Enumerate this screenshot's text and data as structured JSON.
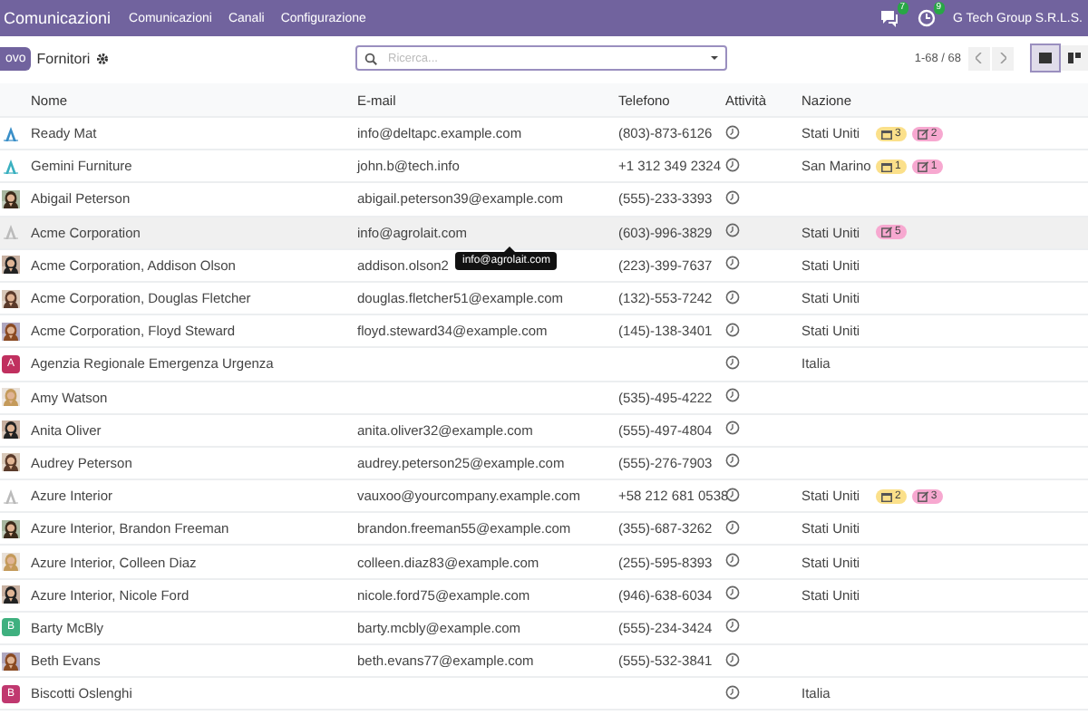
{
  "topbar": {
    "app": "Comunicazioni",
    "menus": [
      "Comunicazioni",
      "Canali",
      "Configurazione"
    ],
    "chat_badge": "7",
    "activity_badge": "9",
    "company": "G Tech Group S.R.L.S."
  },
  "control": {
    "new_button": "ovo",
    "title": "Fornitori",
    "search": {
      "placeholder": "Ricerca..."
    },
    "pager": "1-68 / 68",
    "views": [
      {
        "kind": "list",
        "selected": true
      },
      {
        "kind": "kanban",
        "selected": false
      }
    ]
  },
  "table": {
    "columns": [
      "Nome",
      "E-mail",
      "Telefono",
      "Attività",
      "Nazione"
    ],
    "rows": [
      {
        "avatar": {
          "kind": "logo"
        },
        "name": "Ready Mat",
        "email": "info@deltapc.example.com",
        "phone": "(803)-873-6126",
        "country": "Stati Uniti",
        "tags": [
          {
            "kind": "calendar",
            "count": "3"
          },
          {
            "kind": "note",
            "count": "2"
          }
        ],
        "highlighted": false
      },
      {
        "avatar": {
          "kind": "logo"
        },
        "name": "Gemini Furniture",
        "email": "john.b@tech.info",
        "phone": "+1 312 349 2324",
        "country": "San Marino",
        "tags": [
          {
            "kind": "calendar",
            "count": "1"
          },
          {
            "kind": "note",
            "count": "1"
          }
        ],
        "highlighted": false
      },
      {
        "name": "Abigail Peterson",
        "email": "abigail.peterson39@example.com",
        "phone": "(555)-233-3393",
        "highlighted": false
      },
      {
        "avatar": {
          "kind": "logo"
        },
        "name": "Acme Corporation",
        "email": "info@agrolait.com",
        "phone": "(603)-996-3829",
        "country": "Stati Uniti",
        "tags": [
          {
            "kind": "note",
            "count": "5"
          }
        ],
        "highlighted": true
      },
      {
        "name": "Acme Corporation, Addison Olson",
        "email": "addison.olson2",
        "phone": "(223)-399-7637",
        "country": "Stati Uniti",
        "tooltip": "info@agrolait.com",
        "highlighted": false
      },
      {
        "name": "Acme Corporation, Douglas Fletcher",
        "email": "douglas.fletcher51@example.com",
        "phone": "(132)-553-7242",
        "country": "Stati Uniti",
        "highlighted": false
      },
      {
        "name": "Acme Corporation, Floyd Steward",
        "email": "floyd.steward34@example.com",
        "phone": "(145)-138-3401",
        "country": "Stati Uniti",
        "highlighted": false
      },
      {
        "avatar": {
          "kind": "letter",
          "letter": "A",
          "color": "#c0305f"
        },
        "name": "Agenzia Regionale Emergenza Urgenza",
        "country": "Italia",
        "highlighted": false
      },
      {
        "name": "Amy Watson",
        "phone": "(535)-495-4222",
        "highlighted": false
      },
      {
        "name": "Anita Oliver",
        "email": "anita.oliver32@example.com",
        "phone": "(555)-497-4804",
        "highlighted": false
      },
      {
        "name": "Audrey Peterson",
        "email": "audrey.peterson25@example.com",
        "phone": "(555)-276-7903",
        "highlighted": false
      },
      {
        "avatar": {
          "kind": "logo"
        },
        "name": "Azure Interior",
        "email": "vauxoo@yourcompany.example.com",
        "phone": "+58 212 681 0538",
        "country": "Stati Uniti",
        "tags": [
          {
            "kind": "calendar",
            "count": "2"
          },
          {
            "kind": "note",
            "count": "3"
          }
        ],
        "highlighted": false
      },
      {
        "name": "Azure Interior, Brandon Freeman",
        "email": "brandon.freeman55@example.com",
        "phone": "(355)-687-3262",
        "country": "Stati Uniti",
        "highlighted": false
      },
      {
        "name": "Azure Interior, Colleen Diaz",
        "email": "colleen.diaz83@example.com",
        "phone": "(255)-595-8393",
        "country": "Stati Uniti",
        "highlighted": false
      },
      {
        "name": "Azure Interior, Nicole Ford",
        "email": "nicole.ford75@example.com",
        "phone": "(946)-638-6034",
        "country": "Stati Uniti",
        "highlighted": false
      },
      {
        "avatar": {
          "kind": "letter",
          "letter": "B",
          "color": "#3fb07f"
        },
        "name": "Barty McBly",
        "email": "barty.mcbly@example.com",
        "phone": "(555)-234-3424",
        "highlighted": false
      },
      {
        "name": "Beth Evans",
        "email": "beth.evans77@example.com",
        "phone": "(555)-532-3841",
        "highlighted": false
      },
      {
        "avatar": {
          "kind": "letter",
          "letter": "B",
          "color": "#c0386f"
        },
        "name": "Biscotti Oslenghi",
        "country": "Italia",
        "highlighted": false
      }
    ]
  }
}
